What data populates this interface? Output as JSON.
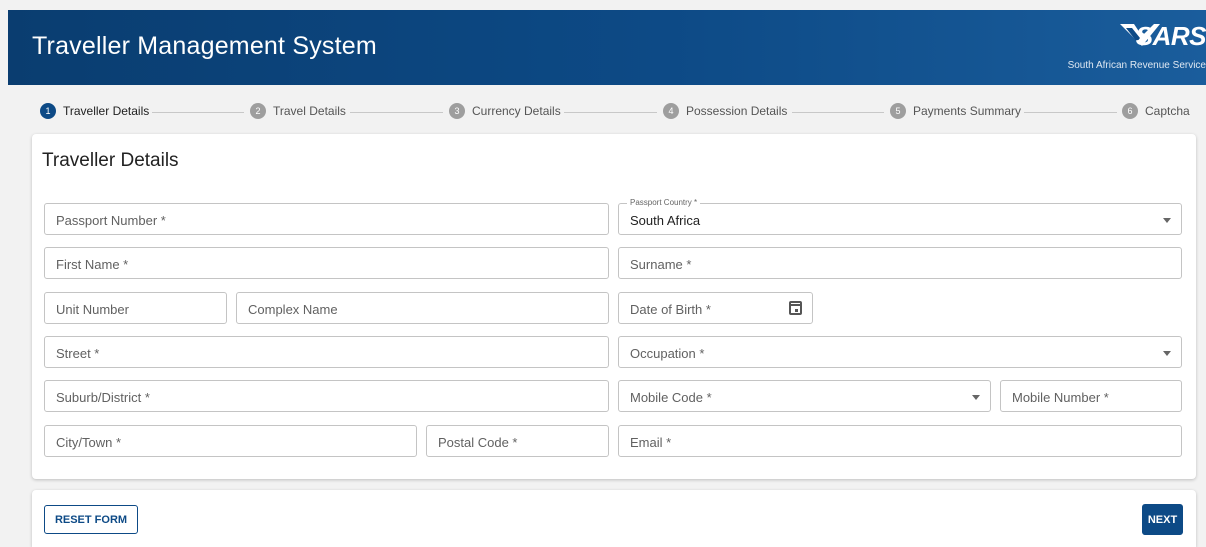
{
  "header": {
    "title": "Traveller Management System",
    "logo": {
      "wordmark": "SARS",
      "tagline": "South African Revenue Service",
      "icon": "sars-chevron-icon"
    }
  },
  "stepper": {
    "steps": [
      {
        "number": "1",
        "label": "Traveller Details",
        "active": true
      },
      {
        "number": "2",
        "label": "Travel Details",
        "active": false
      },
      {
        "number": "3",
        "label": "Currency Details",
        "active": false
      },
      {
        "number": "4",
        "label": "Possession Details",
        "active": false
      },
      {
        "number": "5",
        "label": "Payments Summary",
        "active": false
      },
      {
        "number": "6",
        "label": "Captcha",
        "active": false
      }
    ]
  },
  "form": {
    "title": "Traveller Details",
    "fields": {
      "passport_number": {
        "placeholder": "Passport Number *"
      },
      "passport_country": {
        "label": "Passport Country *",
        "value": "South Africa"
      },
      "first_name": {
        "placeholder": "First Name *"
      },
      "surname": {
        "placeholder": "Surname *"
      },
      "unit_number": {
        "placeholder": "Unit Number"
      },
      "complex_name": {
        "placeholder": "Complex Name"
      },
      "date_of_birth": {
        "placeholder": "Date of Birth *"
      },
      "street": {
        "placeholder": "Street *"
      },
      "occupation": {
        "placeholder": "Occupation *"
      },
      "suburb": {
        "placeholder": "Suburb/District *"
      },
      "mobile_code": {
        "placeholder": "Mobile Code *"
      },
      "mobile_number": {
        "placeholder": "Mobile Number *"
      },
      "city": {
        "placeholder": "City/Town *"
      },
      "postal_code": {
        "placeholder": "Postal Code *"
      },
      "email": {
        "placeholder": "Email *"
      }
    }
  },
  "actions": {
    "reset_label": "RESET FORM",
    "next_label": "NEXT"
  },
  "colors": {
    "primary": "#0d4a86",
    "header_dark": "#0a3d70",
    "inactive_step": "#9e9e9e"
  }
}
